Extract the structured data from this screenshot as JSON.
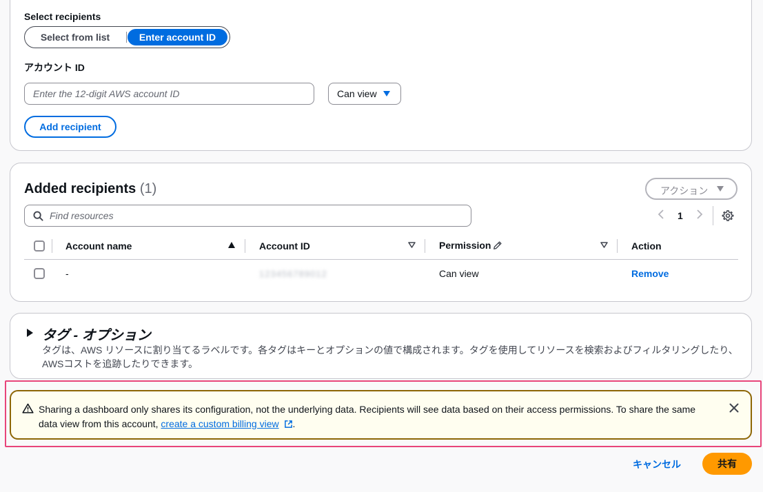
{
  "recipients": {
    "select_label": "Select recipients",
    "seg_list": "Select from list",
    "seg_account": "Enter account ID",
    "account_id_label": "アカウント ID",
    "account_placeholder": "Enter the 12-digit AWS account ID",
    "permission_value": "Can view",
    "add_button": "Add recipient"
  },
  "added": {
    "title": "Added recipients",
    "count": "(1)",
    "actions_label": "アクション",
    "search_placeholder": "Find resources",
    "page": "1",
    "columns": {
      "account_name": "Account name",
      "account_id": "Account ID",
      "permission": "Permission",
      "action": "Action"
    },
    "rows": [
      {
        "account_name": "-",
        "account_id": "123456789012",
        "permission": "Can view",
        "action": "Remove"
      }
    ]
  },
  "tags": {
    "title": "タグ - オプション",
    "description": "タグは、AWS リソースに割り当てるラベルです。各タグはキーとオプションの値で構成されます。タグを使用してリソースを検索およびフィルタリングしたり、AWSコストを追跡したりできます。"
  },
  "alert": {
    "text": "Sharing a dashboard only shares its configuration, not the underlying data. Recipients will see data based on their access permissions. To share the same data view from this account, ",
    "link": "create a custom billing view",
    "suffix": "."
  },
  "footer": {
    "cancel": "キャンセル",
    "share": "共有"
  },
  "colors": {
    "accent": "#006ce0",
    "primary": "#ff9900",
    "warning_border": "#8d6605",
    "highlight": "#e8447a"
  }
}
